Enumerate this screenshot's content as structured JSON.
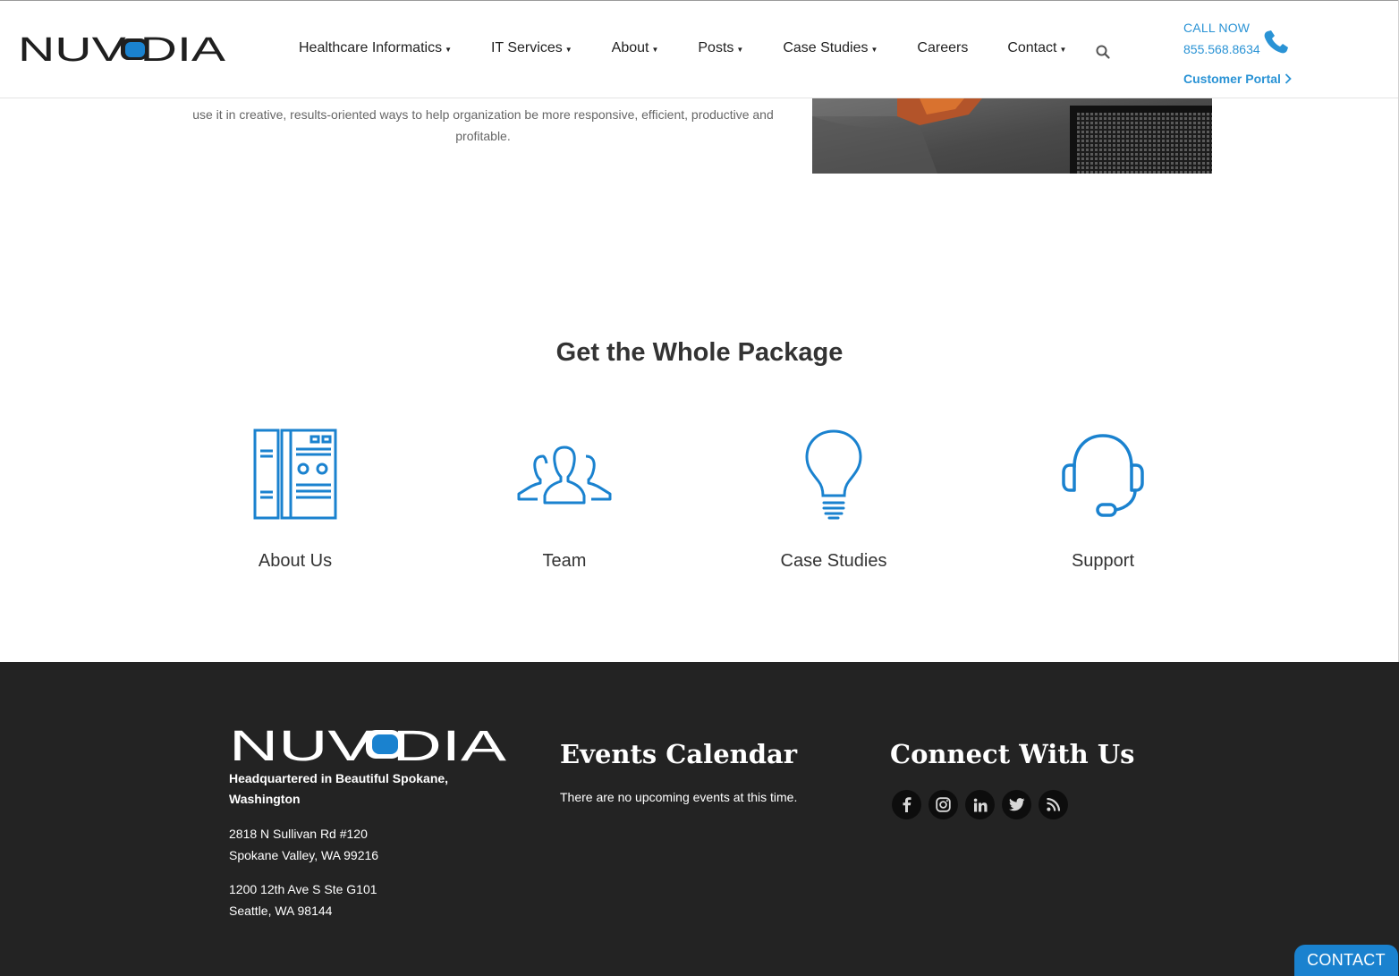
{
  "brand": {
    "name": "NUVODIA",
    "accent": "#1a82cf",
    "link_color": "#2a93d5",
    "footer_bg": "#232323"
  },
  "header": {
    "nav": [
      {
        "label": "Healthcare Informatics",
        "has_dropdown": true
      },
      {
        "label": "IT Services",
        "has_dropdown": true
      },
      {
        "label": "About",
        "has_dropdown": true
      },
      {
        "label": "Posts",
        "has_dropdown": true
      },
      {
        "label": "Case Studies",
        "has_dropdown": true
      },
      {
        "label": "Careers",
        "has_dropdown": false
      },
      {
        "label": "Contact",
        "has_dropdown": true
      }
    ],
    "search_icon": "search-icon",
    "call_now_label": "CALL NOW",
    "phone_number": "855.568.8634",
    "customer_portal_label": "Customer Portal"
  },
  "intro": {
    "text": "use it in creative, results-oriented ways to help organization be more responsive, efficient, productive and profitable."
  },
  "package": {
    "title": "Get the Whole Package",
    "items": [
      {
        "label": "About Us",
        "icon": "binders-icon"
      },
      {
        "label": "Team",
        "icon": "team-icon"
      },
      {
        "label": "Case Studies",
        "icon": "lightbulb-icon"
      },
      {
        "label": "Support",
        "icon": "headset-icon"
      }
    ]
  },
  "footer": {
    "hq_text": "Headquartered in Beautiful Spokane, Washington",
    "addresses": [
      {
        "line1": "2818 N Sullivan Rd #120",
        "line2": "Spokane Valley, WA 99216"
      },
      {
        "line1": "1200 12th Ave S Ste G101",
        "line2": "Seattle, WA 98144"
      }
    ],
    "events_heading": "Events Calendar",
    "events_text": "There are no upcoming events at this time.",
    "connect_heading": "Connect With Us",
    "social": [
      "facebook-icon",
      "instagram-icon",
      "linkedin-icon",
      "twitter-icon",
      "rss-icon"
    ]
  },
  "contact_tab": "CONTACT"
}
